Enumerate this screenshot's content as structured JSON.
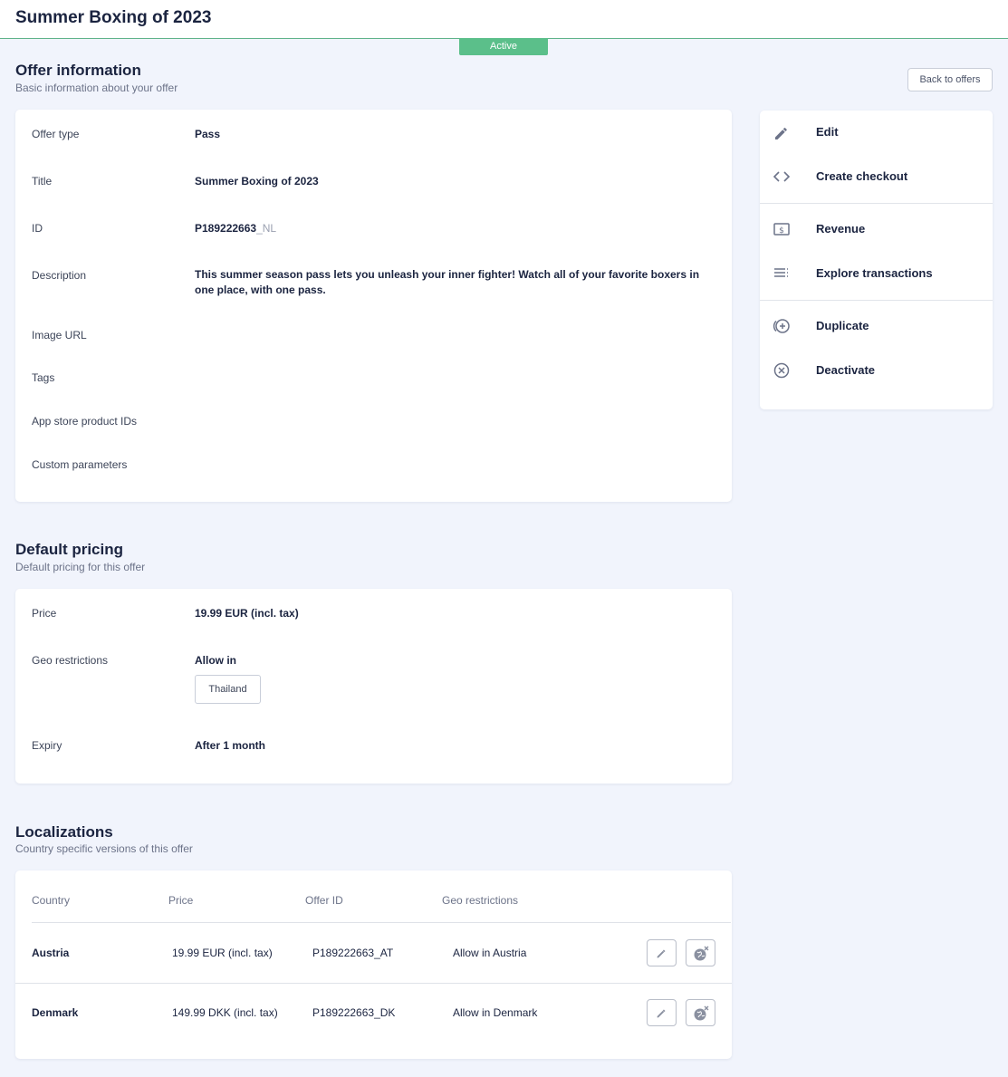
{
  "header": {
    "title": "Summer Boxing of 2023",
    "status": "Active"
  },
  "offer_info": {
    "title": "Offer information",
    "subtitle": "Basic information about your offer",
    "back_label": "Back to offers",
    "rows": [
      {
        "label": "Offer type",
        "value": "Pass"
      },
      {
        "label": "Title",
        "value": "Summer Boxing of 2023"
      },
      {
        "label": "ID",
        "value": "P189222663",
        "suffix": "_NL"
      },
      {
        "label": "Description",
        "value": "This summer season pass lets you unleash your inner fighter! Watch all of your favorite boxers in one place, with one pass."
      },
      {
        "label": "Image URL",
        "value": ""
      },
      {
        "label": "Tags",
        "value": ""
      },
      {
        "label": "App store product IDs",
        "value": ""
      },
      {
        "label": "Custom parameters",
        "value": ""
      }
    ]
  },
  "actions": [
    {
      "label": "Edit",
      "icon": "pencil-icon"
    },
    {
      "label": "Create checkout",
      "icon": "code-icon"
    },
    {
      "label": "Revenue",
      "icon": "dollar-icon"
    },
    {
      "label": "Explore transactions",
      "icon": "list-icon"
    },
    {
      "label": "Duplicate",
      "icon": "duplicate-icon"
    },
    {
      "label": "Deactivate",
      "icon": "x-circle-icon"
    }
  ],
  "pricing": {
    "title": "Default pricing",
    "subtitle": "Default pricing for this offer",
    "price_label": "Price",
    "price_value": "19.99 EUR (incl. tax)",
    "geo_label": "Geo restrictions",
    "geo_value": "Allow in",
    "geo_tag": "Thailand",
    "expiry_label": "Expiry",
    "expiry_value": "After 1 month"
  },
  "localizations": {
    "title": "Localizations",
    "subtitle": "Country specific versions of this offer",
    "columns": [
      "Country",
      "Price",
      "Offer ID",
      "Geo restrictions"
    ],
    "rows": [
      {
        "country": "Austria",
        "price": "19.99 EUR (incl. tax)",
        "offer_id": "P189222663_AT",
        "geo": "Allow in Austria"
      },
      {
        "country": "Denmark",
        "price": "149.99 DKK (incl. tax)",
        "offer_id": "P189222663_DK",
        "geo": "Allow in Denmark"
      }
    ]
  },
  "colors": {
    "accent": "#5bbf8a",
    "text": "#1b2440",
    "background": "#f1f4fc"
  }
}
